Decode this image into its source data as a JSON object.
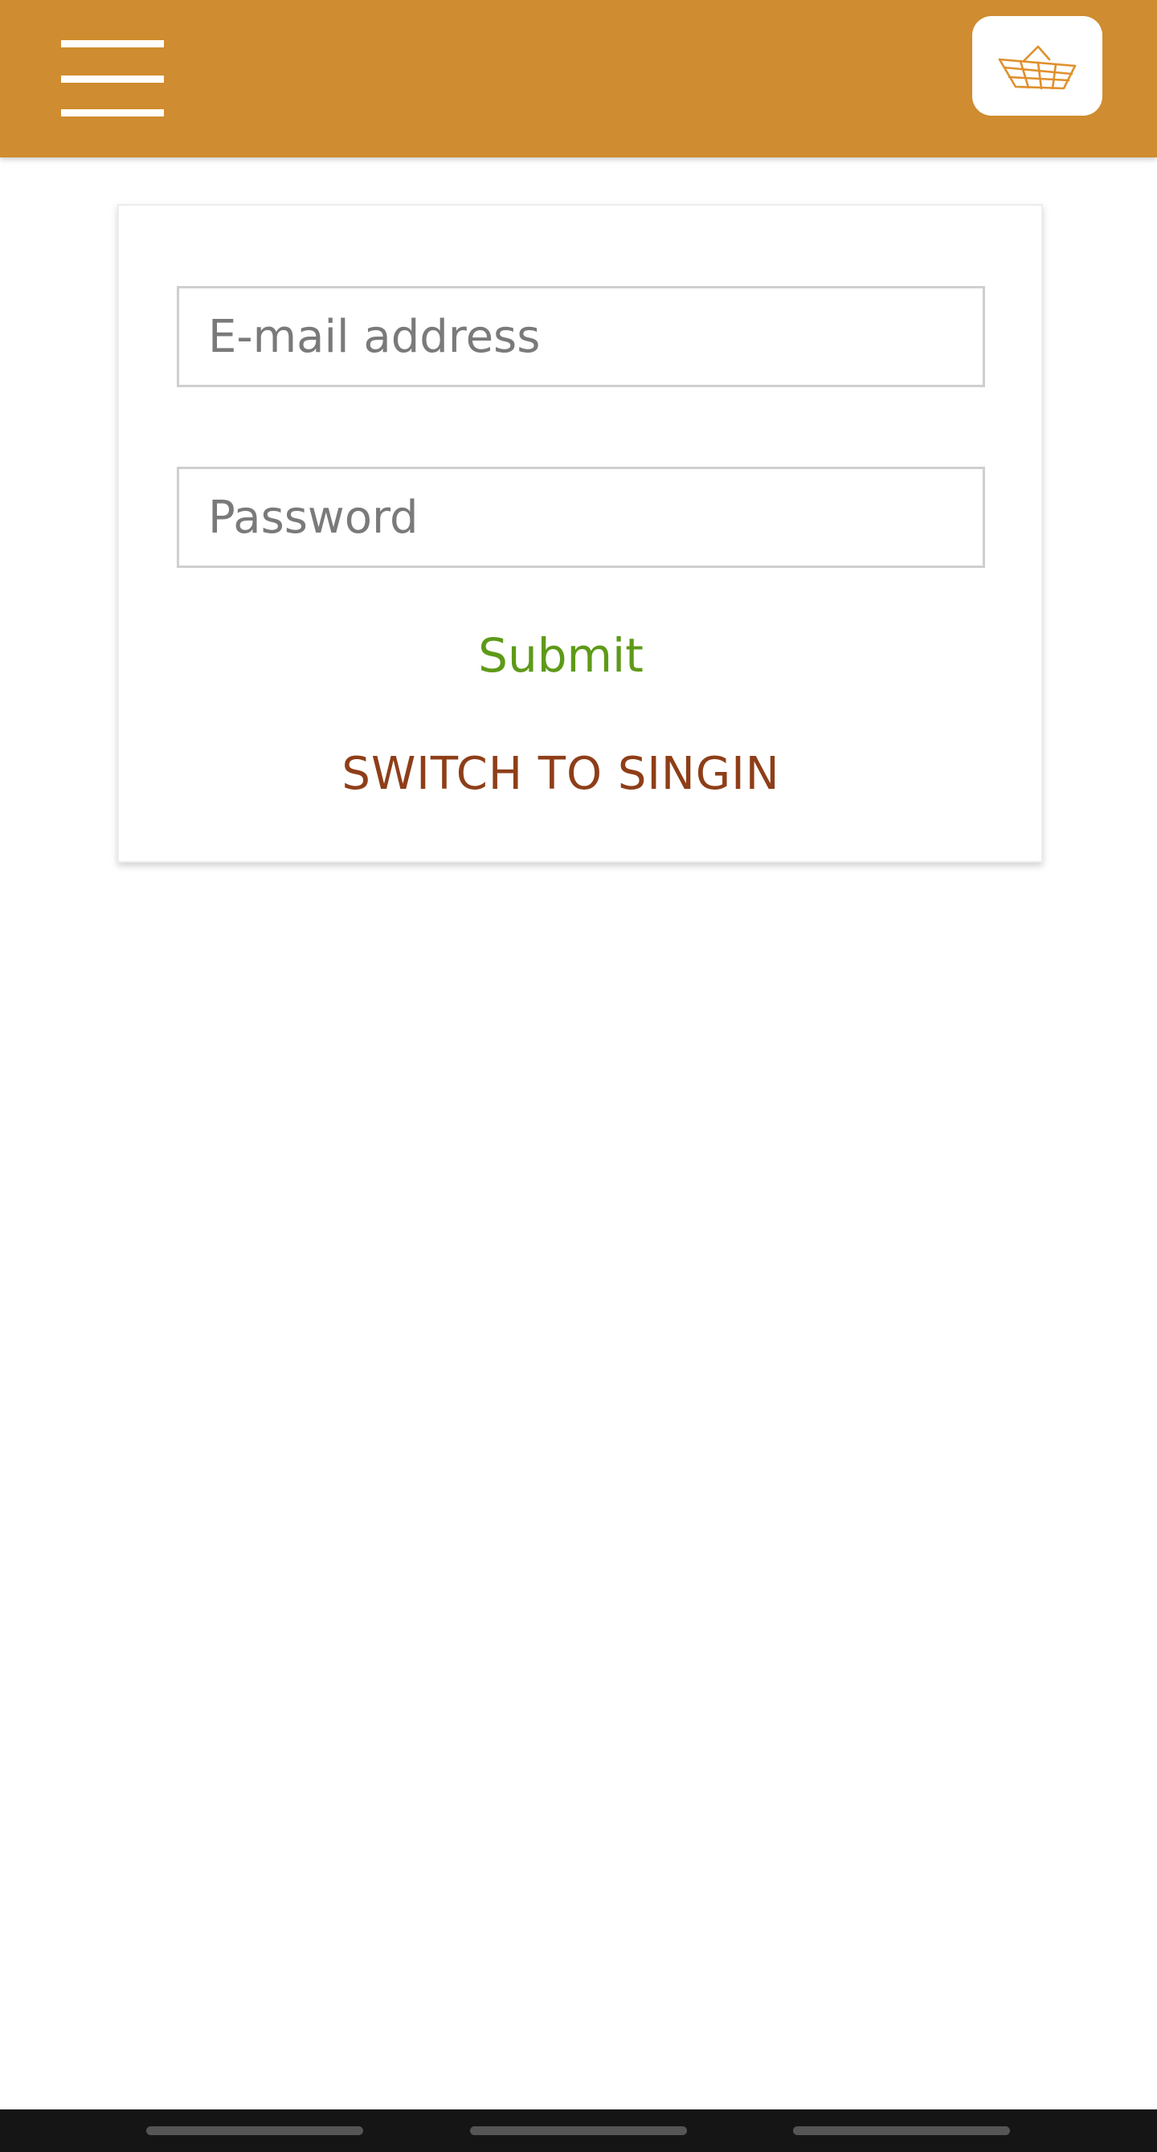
{
  "header": {
    "menu_icon": "hamburger-menu-icon",
    "cart_icon": "basket-icon",
    "background_color": "#cf8c30"
  },
  "login_form": {
    "email": {
      "placeholder": "E-mail address",
      "value": ""
    },
    "password": {
      "placeholder": "Password",
      "value": ""
    },
    "submit_label": "Submit",
    "switch_label": "SWITCH TO SINGIN"
  },
  "colors": {
    "accent": "#cf8c30",
    "submit_text": "#5e9a18",
    "switch_text": "#8e3e18",
    "nav_bar": "#151515"
  }
}
